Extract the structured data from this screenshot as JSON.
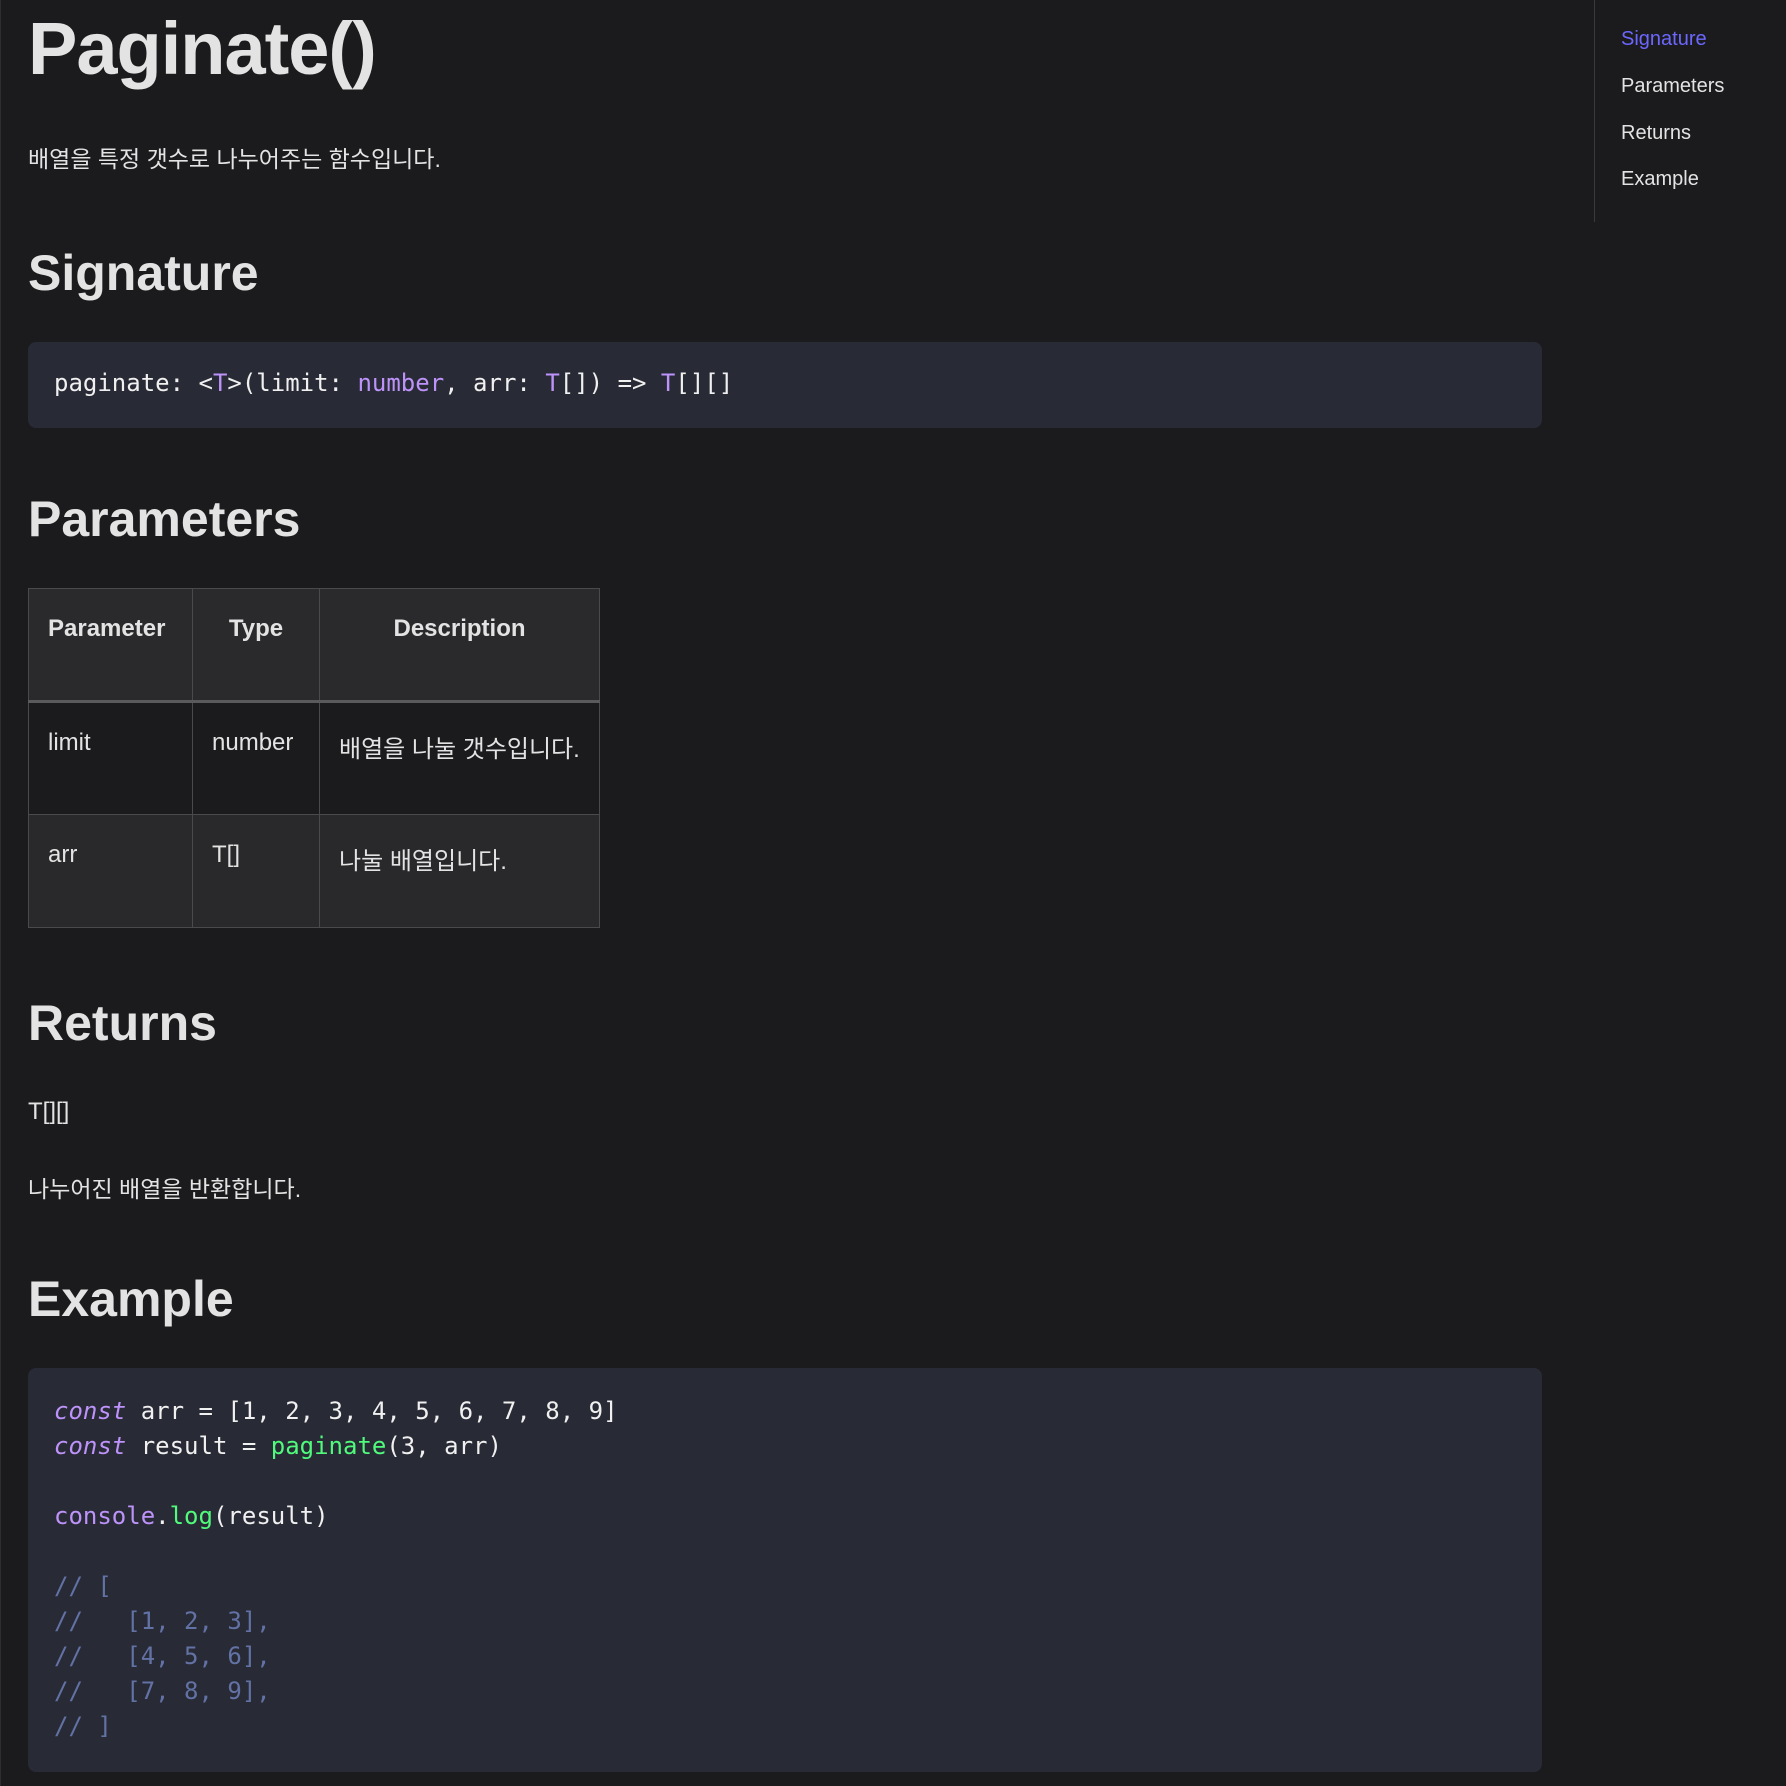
{
  "page": {
    "title": "Paginate()",
    "intro": "배열을 특정 갯수로 나누어주는 함수입니다."
  },
  "sections": {
    "signature": "Signature",
    "parameters": "Parameters",
    "returns": "Returns",
    "example": "Example"
  },
  "signature_code": {
    "p1": "paginate: <",
    "t1": "T",
    "p2": ">(limit: ",
    "t2": "number",
    "p3": ", arr: ",
    "t3": "T",
    "p4": "[]) => ",
    "t4": "T",
    "p5": "[][]"
  },
  "params_table": {
    "headers": [
      "Parameter",
      "Type",
      "Description"
    ],
    "rows": [
      {
        "name": "limit",
        "type": "number",
        "description": "배열을 나눌 갯수입니다."
      },
      {
        "name": "arr",
        "type": "T[]",
        "description": "나눌 배열입니다."
      }
    ]
  },
  "returns": {
    "type": "T[][]",
    "description": "나누어진 배열을 반환합니다."
  },
  "example_code": {
    "l1_kw": "const",
    "l1_rest": " arr = [1, 2, 3, 4, 5, 6, 7, 8, 9]",
    "l2_kw": "const",
    "l2_mid": " result = ",
    "l2_fn": "paginate",
    "l2_rest": "(3, arr)",
    "l4_obj": "console",
    "l4_dot": ".",
    "l4_fn": "log",
    "l4_rest": "(result)",
    "c1": "// [",
    "c2": "//   [1, 2, 3],",
    "c3": "//   [4, 5, 6],",
    "c4": "//   [7, 8, 9],",
    "c5": "// ]"
  },
  "toc": {
    "items": [
      "Signature",
      "Parameters",
      "Returns",
      "Example"
    ],
    "active": "Signature",
    "active_color": "#6b67ff"
  },
  "colors": {
    "background": "#1b1b1d",
    "code_background": "#282a36",
    "keyword": "#bd93f9",
    "function": "#50fa7b",
    "comment": "#6272a4"
  }
}
